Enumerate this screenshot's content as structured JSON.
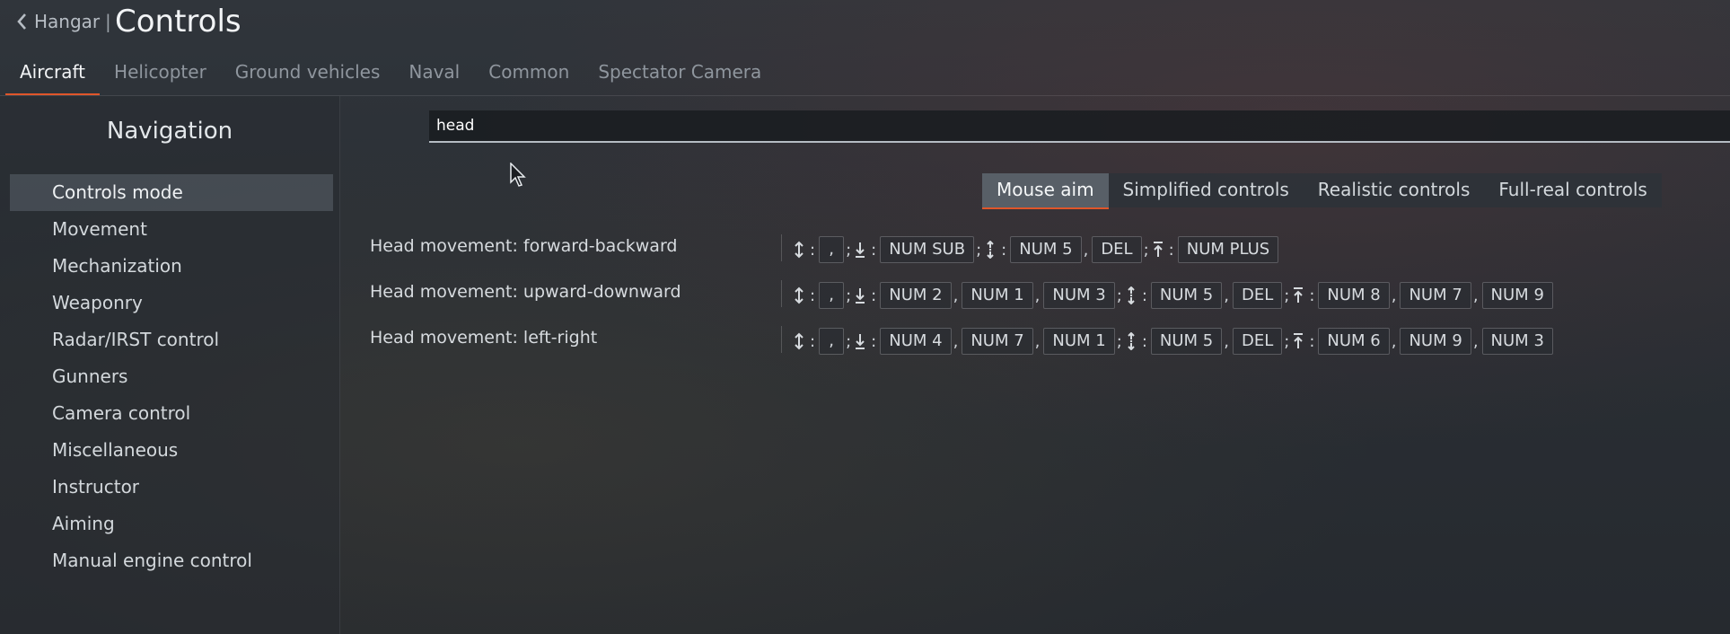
{
  "header": {
    "back_label": "Hangar",
    "separator": "|",
    "title": "Controls"
  },
  "tabs": [
    {
      "label": "Aircraft"
    },
    {
      "label": "Helicopter"
    },
    {
      "label": "Ground vehicles"
    },
    {
      "label": "Naval"
    },
    {
      "label": "Common"
    },
    {
      "label": "Spectator Camera"
    }
  ],
  "sidebar": {
    "title": "Navigation",
    "items": [
      {
        "label": "Controls mode"
      },
      {
        "label": "Movement"
      },
      {
        "label": "Mechanization"
      },
      {
        "label": "Weaponry"
      },
      {
        "label": "Radar/IRST control"
      },
      {
        "label": "Gunners"
      },
      {
        "label": "Camera control"
      },
      {
        "label": "Miscellaneous"
      },
      {
        "label": "Instructor"
      },
      {
        "label": "Aiming"
      },
      {
        "label": "Manual engine control"
      }
    ]
  },
  "search": {
    "value": "head"
  },
  "modes": [
    {
      "label": "Mouse aim"
    },
    {
      "label": "Simplified controls"
    },
    {
      "label": "Realistic controls"
    },
    {
      "label": "Full-real controls"
    }
  ],
  "bindings": [
    {
      "label": "Head movement: forward-backward",
      "axis": ",",
      "dec": [
        "NUM SUB"
      ],
      "relative": [
        "NUM 5",
        "DEL"
      ],
      "inc": [
        "NUM PLUS"
      ]
    },
    {
      "label": "Head movement: upward-downward",
      "axis": ",",
      "dec": [
        "NUM 2",
        "NUM 1",
        "NUM 3"
      ],
      "relative": [
        "NUM 5",
        "DEL"
      ],
      "inc": [
        "NUM 8",
        "NUM 7",
        "NUM 9"
      ]
    },
    {
      "label": "Head movement: left-right",
      "axis": ",",
      "dec": [
        "NUM 4",
        "NUM 7",
        "NUM 1"
      ],
      "relative": [
        "NUM 5",
        "DEL"
      ],
      "inc": [
        "NUM 6",
        "NUM 9",
        "NUM 3"
      ]
    }
  ],
  "colors": {
    "accent": "#e0562a"
  },
  "icons": {
    "back": "chevron-left-icon",
    "axis": "axis-updown-icon",
    "decrease": "axis-decrease-icon",
    "relative": "axis-relative-icon",
    "increase": "axis-increase-icon",
    "pointer": "mouse-pointer-icon"
  }
}
